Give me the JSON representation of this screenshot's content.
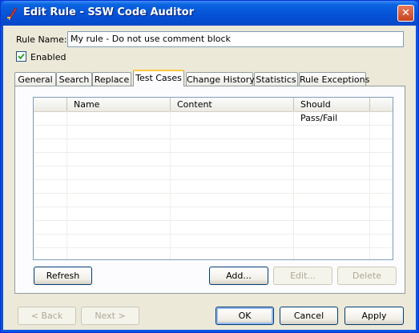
{
  "window": {
    "title": "Edit Rule - SSW Code Auditor",
    "close_glyph": "✕",
    "title_icon": "pencil-rule-icon"
  },
  "rule_name": {
    "label": "Rule Name:",
    "value": "My rule - Do not use comment block"
  },
  "enabled": {
    "label": "Enabled",
    "checked": true
  },
  "tabs": [
    {
      "label": "General"
    },
    {
      "label": "Search"
    },
    {
      "label": "Replace"
    },
    {
      "label": "Test Cases",
      "active": true
    },
    {
      "label": "Change History"
    },
    {
      "label": "Statistics"
    },
    {
      "label": "Rule Exceptions"
    }
  ],
  "grid": {
    "columns": [
      "",
      "Name",
      "Content",
      "Should Pass/Fail"
    ],
    "rows": []
  },
  "panel_buttons": {
    "refresh": "Refresh",
    "add": "Add...",
    "edit": "Edit...",
    "delete": "Delete"
  },
  "footer_buttons": {
    "back": "< Back",
    "next": "Next >",
    "ok": "OK",
    "cancel": "Cancel",
    "apply": "Apply"
  },
  "colors": {
    "titlebar": "#0552d7",
    "dialog_bg": "#ece9d8",
    "active_tab_accent": "#ffc83c",
    "close_button": "#c8421c"
  }
}
